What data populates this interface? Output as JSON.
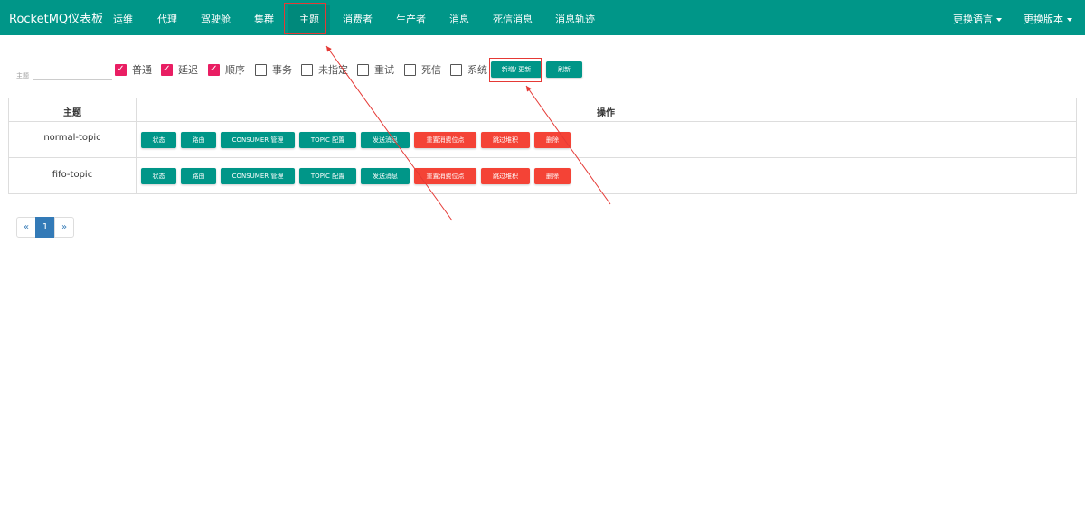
{
  "navbar": {
    "brand": "RocketMQ仪表板",
    "items": [
      "运维",
      "代理",
      "驾驶舱",
      "集群",
      "主题",
      "消费者",
      "生产者",
      "消息",
      "死信消息",
      "消息轨迹"
    ],
    "active_item": "主题",
    "language": "更换语言",
    "version": "更换版本"
  },
  "filter": {
    "search_label": "主题",
    "search_value": "",
    "checkboxes": [
      {
        "label": "普通",
        "checked": true
      },
      {
        "label": "延迟",
        "checked": true
      },
      {
        "label": "顺序",
        "checked": true
      },
      {
        "label": "事务",
        "checked": false
      },
      {
        "label": "未指定",
        "checked": false
      },
      {
        "label": "重试",
        "checked": false
      },
      {
        "label": "死信",
        "checked": false
      },
      {
        "label": "系统",
        "checked": false
      }
    ],
    "add_update": "新增/ 更新",
    "refresh": "刷新"
  },
  "table": {
    "headers": [
      "主题",
      "操作"
    ],
    "rows": [
      {
        "topic": "normal-topic"
      },
      {
        "topic": "fifo-topic"
      }
    ],
    "actions": [
      "状态",
      "路由",
      "CONSUMER 管理",
      "TOPIC 配置",
      "发送消息",
      "重置消费位点",
      "跳过堆积",
      "删除"
    ]
  },
  "pagination": {
    "prev": "«",
    "current": "1",
    "next": "»"
  },
  "colors": {
    "primary": "#009688",
    "danger": "#f44336",
    "checkbox": "#e91e63",
    "pager_active": "#337ab7",
    "annotation": "#e53935"
  }
}
